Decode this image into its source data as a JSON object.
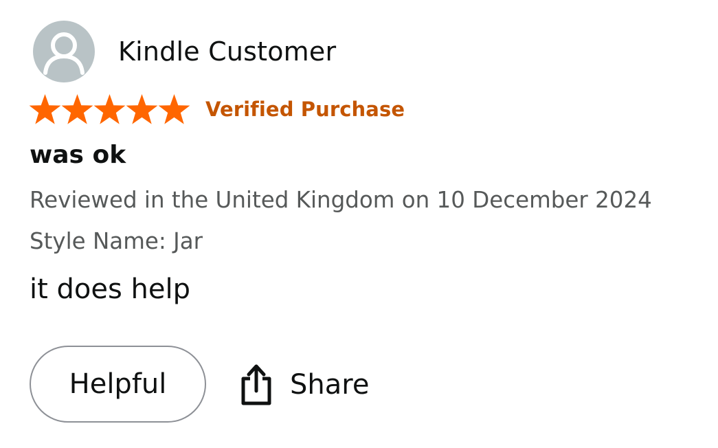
{
  "review": {
    "profile": {
      "name": "Kindle Customer",
      "avatar_icon": "user-silhouette-icon"
    },
    "rating": {
      "stars": 5,
      "out_of": 5,
      "star_color": "#ff6600",
      "verified_label": "Verified Purchase",
      "verified_color": "#c45500"
    },
    "title": "was ok",
    "date_line": "Reviewed in the United Kingdom on 10 December 2024",
    "style_line": "Style Name: Jar",
    "body": "it does help",
    "actions": {
      "helpful_label": "Helpful",
      "share_label": "Share",
      "share_icon": "share-upload-icon"
    }
  }
}
